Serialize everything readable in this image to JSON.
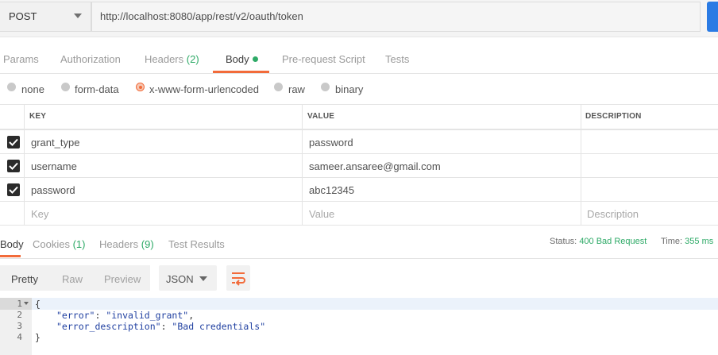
{
  "request": {
    "method": "POST",
    "url": "http://localhost:8080/app/rest/v2/oauth/token"
  },
  "request_tabs": {
    "params": "Params",
    "authorization": "Authorization",
    "headers": "Headers",
    "headers_count": "(2)",
    "body": "Body",
    "prerequest": "Pre-request Script",
    "tests": "Tests"
  },
  "body_types": {
    "none": "none",
    "form_data": "form-data",
    "urlencoded": "x-www-form-urlencoded",
    "raw": "raw",
    "binary": "binary",
    "selected": "x-www-form-urlencoded"
  },
  "table": {
    "headers": {
      "key": "KEY",
      "value": "VALUE",
      "description": "DESCRIPTION"
    },
    "rows": [
      {
        "checked": true,
        "key": "grant_type",
        "value": "password",
        "description": ""
      },
      {
        "checked": true,
        "key": "username",
        "value": "sameer.ansaree@gmail.com",
        "description": ""
      },
      {
        "checked": true,
        "key": "password",
        "value": "abc12345",
        "description": ""
      }
    ],
    "placeholders": {
      "key": "Key",
      "value": "Value",
      "description": "Description"
    }
  },
  "response_tabs": {
    "body": "Body",
    "cookies": "Cookies",
    "cookies_count": "(1)",
    "headers": "Headers",
    "headers_count": "(9)",
    "test_results": "Test Results"
  },
  "response_status": {
    "status_label": "Status:",
    "status_value": "400 Bad Request",
    "time_label": "Time:",
    "time_value": "355 ms"
  },
  "response_toolbar": {
    "pretty": "Pretty",
    "raw": "Raw",
    "preview": "Preview",
    "format": "JSON"
  },
  "response_code": {
    "line_numbers": [
      "1",
      "2",
      "3",
      "4"
    ],
    "open_brace": "{",
    "close_brace": "}",
    "key1": "\"error\"",
    "val1": "\"invalid_grant\"",
    "key2": "\"error_description\"",
    "val2": "\"Bad credentials\""
  },
  "colors": {
    "accent": "#f26b3a",
    "status_green": "#2eaa67",
    "send_blue": "#2a7be4"
  }
}
